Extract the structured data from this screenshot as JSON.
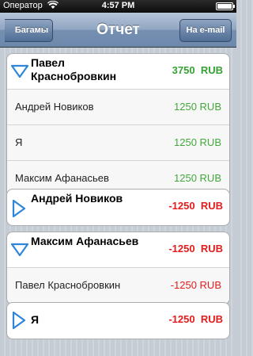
{
  "status": {
    "carrier": "Оператор",
    "time": "4:57 PM"
  },
  "navbar": {
    "back_label": "Багамы",
    "title": "Отчет",
    "email_label": "На e-mail"
  },
  "colors": {
    "positive": "#35a133",
    "negative": "#e41c1c",
    "disclosure": "#2f86d8"
  },
  "groups": [
    {
      "name": "Павел Краснобровкин",
      "amount": "3750",
      "currency": "RUB",
      "expanded": true,
      "rows": [
        {
          "name": "Андрей Новиков",
          "amount": "1250 RUB"
        },
        {
          "name": "Я",
          "amount": "1250 RUB"
        },
        {
          "name": "Максим Афанасьев",
          "amount": "1250 RUB"
        }
      ]
    },
    {
      "name": "Андрей Новиков",
      "amount": "-1250",
      "currency": "RUB",
      "expanded": false,
      "rows": []
    },
    {
      "name": "Максим Афанасьев",
      "amount": "-1250",
      "currency": "RUB",
      "expanded": true,
      "rows": [
        {
          "name": "Павел Краснобровкин",
          "amount": "-1250 RUB"
        }
      ]
    },
    {
      "name": "Я",
      "amount": "-1250",
      "currency": "RUB",
      "expanded": false,
      "rows": []
    }
  ]
}
